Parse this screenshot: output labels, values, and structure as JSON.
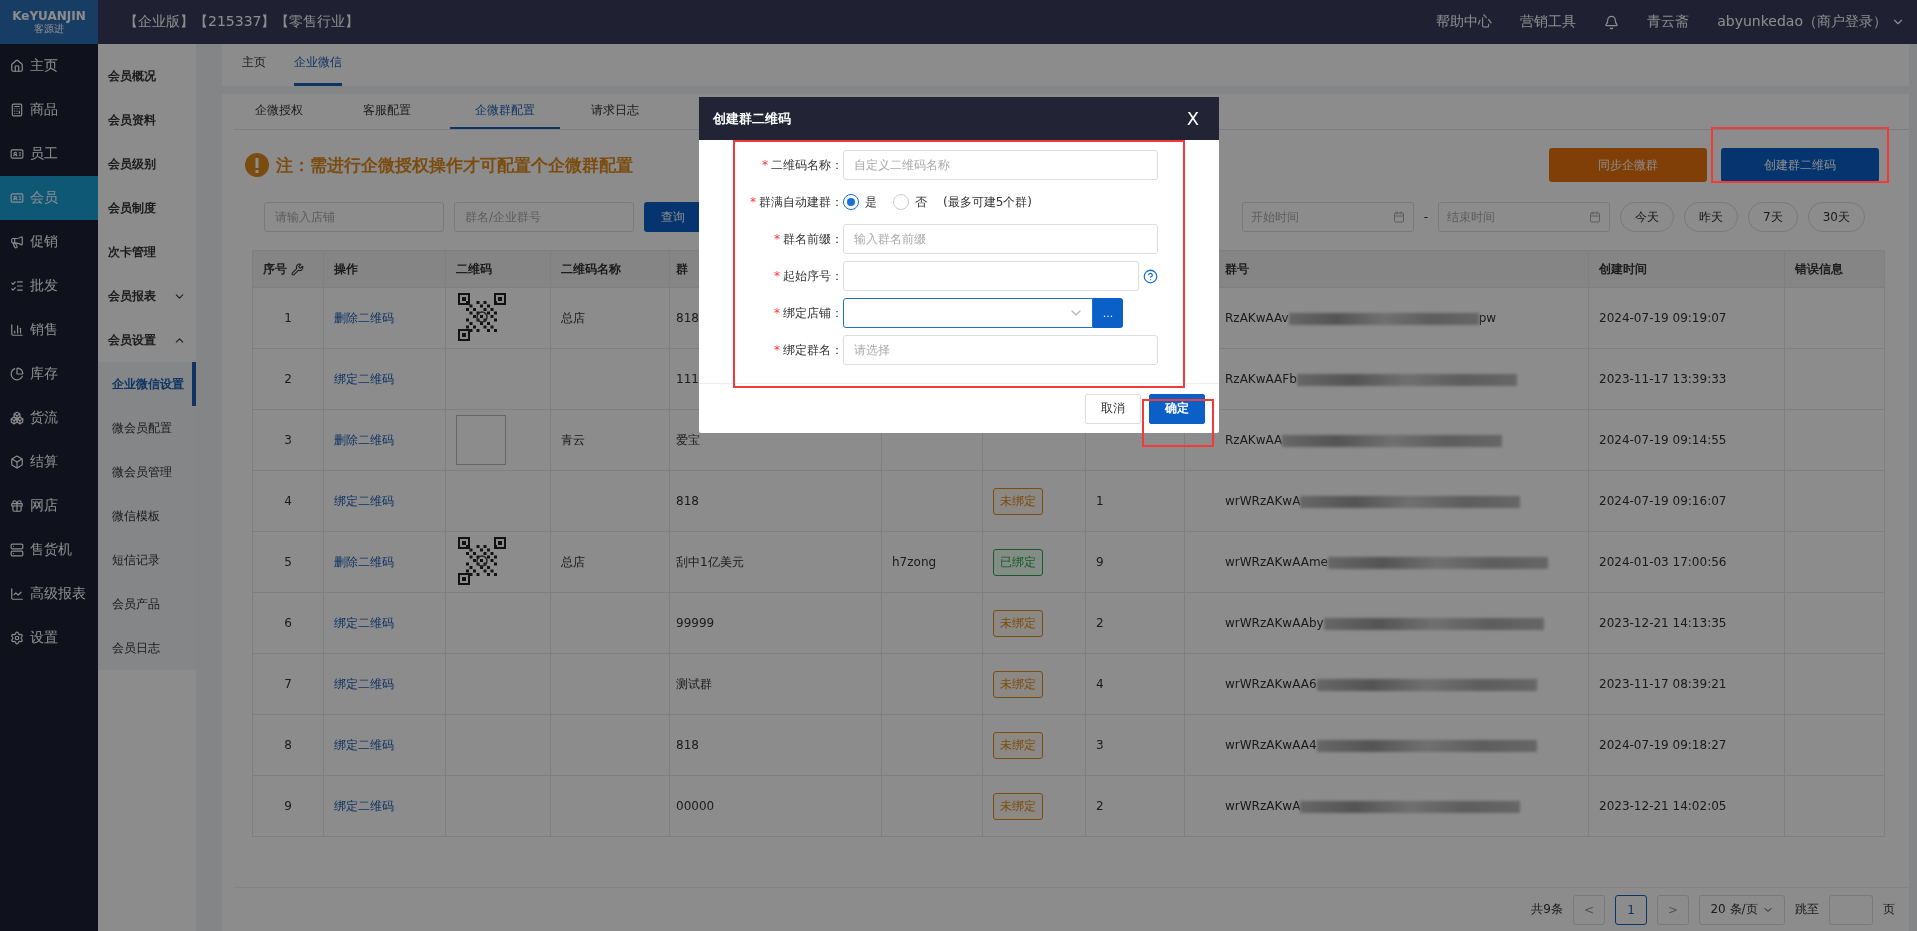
{
  "logo": {
    "title": "KeYUANJIN",
    "subtitle": "客源进"
  },
  "header": {
    "edition": "【企业版】【215337】【零售行业】",
    "links": [
      "帮助中心",
      "营销工具"
    ],
    "shop": "青云斋",
    "account": "abyunkedao（商户登录）"
  },
  "nav": [
    {
      "label": "主页",
      "selected": false
    },
    {
      "label": "商品",
      "selected": false
    },
    {
      "label": "员工",
      "selected": false
    },
    {
      "label": "会员",
      "selected": true
    },
    {
      "label": "促销",
      "selected": false
    },
    {
      "label": "批发",
      "selected": false
    },
    {
      "label": "销售",
      "selected": false
    },
    {
      "label": "库存",
      "selected": false
    },
    {
      "label": "货流",
      "selected": false
    },
    {
      "label": "结算",
      "selected": false
    },
    {
      "label": "网店",
      "selected": false
    },
    {
      "label": "售货机",
      "selected": false
    },
    {
      "label": "高级报表",
      "selected": false
    },
    {
      "label": "设置",
      "selected": false
    }
  ],
  "subnav": [
    {
      "label": "会员概况"
    },
    {
      "label": "会员资料"
    },
    {
      "label": "会员级别"
    },
    {
      "label": "会员制度"
    },
    {
      "label": "次卡管理"
    },
    {
      "label": "会员报表",
      "expanded": false
    },
    {
      "label": "会员设置",
      "expanded": true,
      "children": [
        {
          "label": "企业微信设置",
          "selected": true
        },
        {
          "label": "微会员配置",
          "selected": false
        },
        {
          "label": "微会员管理",
          "selected": false
        },
        {
          "label": "微信模板",
          "selected": false
        },
        {
          "label": "短信记录",
          "selected": false
        },
        {
          "label": "会员产品",
          "selected": false
        },
        {
          "label": "会员日志",
          "selected": false
        }
      ]
    }
  ],
  "page_tabs": [
    {
      "label": "主页",
      "selected": false
    },
    {
      "label": "企业微信",
      "selected": true
    }
  ],
  "sub_tabs": [
    {
      "label": "企微授权",
      "selected": false
    },
    {
      "label": "客服配置",
      "selected": false
    },
    {
      "label": "企微群配置",
      "selected": true
    },
    {
      "label": "请求日志",
      "selected": false
    }
  ],
  "notice": "注：需进行企微授权操作才可配置个企微群配置",
  "actions": [
    {
      "label": "同步企微群",
      "kind": "warning"
    },
    {
      "label": "创建群二维码",
      "kind": "primary"
    }
  ],
  "filters": {
    "store": {
      "placeholder": "请输入店铺"
    },
    "group": {
      "placeholder": "群名/企业群号"
    },
    "search": "查询",
    "start": {
      "placeholder": "开始时间"
    },
    "end": {
      "placeholder": "结束时间"
    },
    "range_sep": "-",
    "quick": [
      "今天",
      "昨天",
      "7天",
      "30天"
    ]
  },
  "table": {
    "columns": [
      "序号",
      "操作",
      "二维码",
      "二维码名称",
      "群",
      "",
      "",
      "",
      "群号",
      "创建时间",
      "错误信息"
    ],
    "rows": [
      {
        "no": "1",
        "action": "删除二维码",
        "qr": {
          "kind": "code"
        },
        "qr_name": "总店",
        "group": "818",
        "group_id": "RzAKwAAv",
        "id_suffix": "pw",
        "created": "2024-07-19 09:19:07"
      },
      {
        "no": "2",
        "action": "绑定二维码",
        "group": "111",
        "group_id": "RzAKwAAFb",
        "created": "2023-11-17 13:39:33"
      },
      {
        "no": "3",
        "action": "删除二维码",
        "qr": {
          "kind": "broken"
        },
        "qr_name": "青云",
        "group": "爱宝",
        "group_id": "RzAKwAA",
        "created": "2024-07-19 09:14:55"
      },
      {
        "no": "4",
        "action": "绑定二维码",
        "group": "818",
        "bound": false,
        "status": "未绑定",
        "count": "1",
        "group_id": "wrWRzAKwA",
        "created": "2024-07-19 09:16:07"
      },
      {
        "no": "5",
        "action": "删除二维码",
        "qr": {
          "kind": "code"
        },
        "qr_name": "总店",
        "group": "刮中1亿美元",
        "owner": "h7zong",
        "bound": true,
        "status": "已绑定",
        "count": "9",
        "group_id": "wrWRzAKwAAme",
        "created": "2024-01-03 17:00:56"
      },
      {
        "no": "6",
        "action": "绑定二维码",
        "group": "99999",
        "bound": false,
        "status": "未绑定",
        "count": "2",
        "group_id": "wrWRzAKwAAby",
        "created": "2023-12-21 14:13:35"
      },
      {
        "no": "7",
        "action": "绑定二维码",
        "group": "测试群",
        "bound": false,
        "status": "未绑定",
        "count": "4",
        "group_id": "wrWRzAKwAA6",
        "created": "2023-11-17 08:39:21"
      },
      {
        "no": "8",
        "action": "绑定二维码",
        "group": "818",
        "bound": false,
        "status": "未绑定",
        "count": "3",
        "group_id": "wrWRzAKwAA4",
        "created": "2024-07-19 09:18:27"
      },
      {
        "no": "9",
        "action": "绑定二维码",
        "group": "00000",
        "bound": false,
        "status": "未绑定",
        "count": "2",
        "group_id": "wrWRzAKwA",
        "created": "2023-12-21 14:02:05"
      }
    ]
  },
  "pagination": {
    "total": "共9条",
    "prev": "<",
    "pages": [
      {
        "label": "1",
        "selected": true
      }
    ],
    "next": ">",
    "size": "20 条/页",
    "jump": "跳至",
    "unit": "页"
  },
  "dialog": {
    "title": "创建群二维码",
    "close": "X",
    "fields": [
      {
        "kind": "text",
        "mark": "*",
        "label": "二维码名称：",
        "placeholder": "自定义二维码名称"
      },
      {
        "kind": "radio",
        "mark": "*",
        "label": "群满自动建群：",
        "options": [
          {
            "label": "是",
            "selected": true
          },
          {
            "label": "否",
            "selected": false
          }
        ],
        "note": "(最多可建5个群)"
      },
      {
        "kind": "text",
        "mark": "*",
        "label": "群名前缀：",
        "placeholder": "输入群名前缀"
      },
      {
        "kind": "help",
        "mark": "*",
        "label": "起始序号："
      },
      {
        "kind": "select",
        "mark": "*",
        "label": "绑定店铺：",
        "button": "..."
      },
      {
        "kind": "text",
        "mark": "*",
        "label": "绑定群名：",
        "placeholder": "请选择"
      }
    ],
    "buttons": [
      {
        "label": "取消",
        "kind": "default"
      },
      {
        "label": "确定",
        "kind": "primary"
      }
    ]
  }
}
